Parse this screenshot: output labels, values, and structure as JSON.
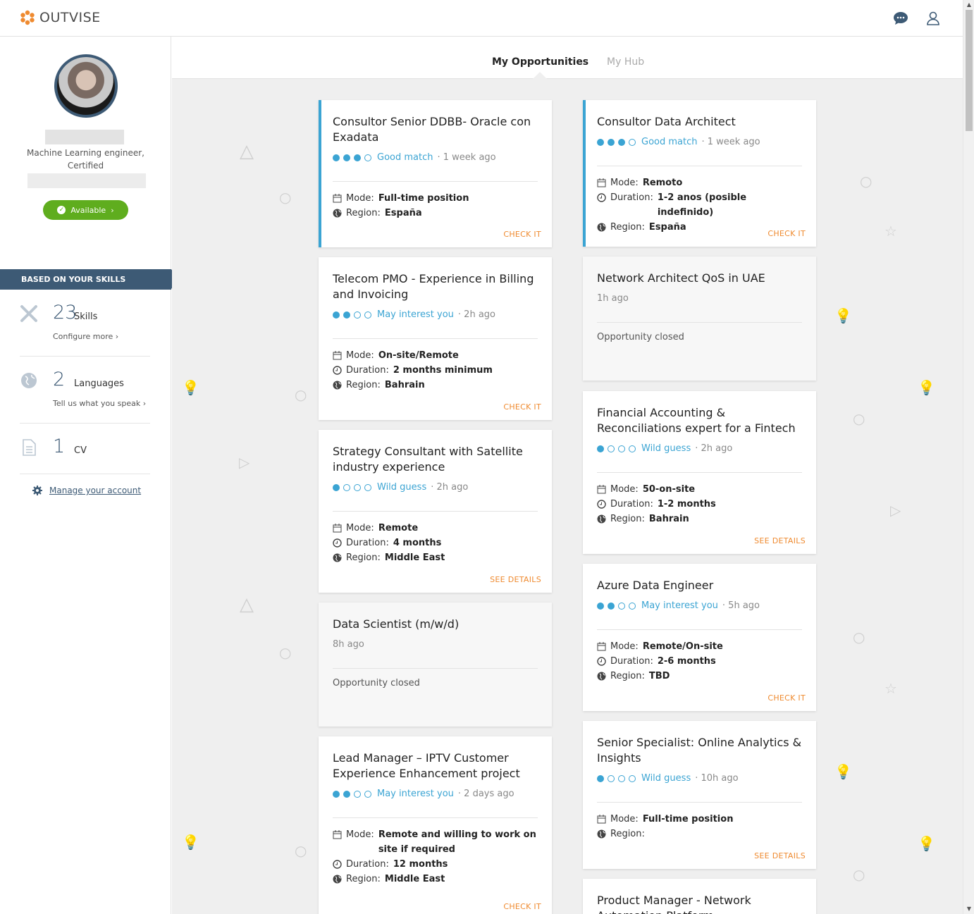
{
  "app": {
    "logo_text": "OUTVISE"
  },
  "header": {
    "chat_icon": "chat-bubble-icon",
    "user_icon": "user-icon"
  },
  "profile": {
    "role": "Machine Learning engineer,",
    "role_line2": "Certified",
    "availability": "Available"
  },
  "skills_banner": "BASED ON YOUR SKILLS",
  "stats": {
    "skills": {
      "count": "23",
      "label": "Skills",
      "link": "Configure more ›"
    },
    "languages": {
      "count": "2",
      "label": "Languages",
      "link": "Tell us what you speak ›"
    },
    "cv": {
      "count": "1",
      "label": "CV"
    }
  },
  "manage_account": "Manage your account",
  "tabs": {
    "active": "My Opportunities",
    "inactive": "My Hub"
  },
  "cards": [
    {
      "title": "Consultor Senior DDBB- Oracle con Exadata",
      "match": "Good match",
      "time": "· 1 week ago",
      "mode": "Full-time position",
      "region": "España",
      "action": "CHECK IT"
    },
    {
      "title": "Telecom PMO - Experience in Billing and Invoicing",
      "match": "May interest you",
      "time": "· 2h ago",
      "mode": "On-site/Remote",
      "duration": "2 months minimum",
      "region": "Bahrain",
      "action": "CHECK IT"
    },
    {
      "title": "Strategy Consultant with Satellite industry experience",
      "match": "Wild guess",
      "time": "· 2h ago",
      "mode": "Remote",
      "duration": "4 months",
      "region": "Middle East",
      "action": "SEE DETAILS"
    },
    {
      "title": "Data Scientist (m/w/d)",
      "time": "8h ago",
      "status": "Opportunity closed"
    },
    {
      "title": "Lead Manager – IPTV Customer Experience Enhancement project",
      "match": "May interest you",
      "time": "· 2 days ago",
      "mode": "Remote and willing to work on site if required",
      "duration": "12 months",
      "region": "Middle East",
      "action": "CHECK IT"
    },
    {
      "title": "Consultor Data Architect",
      "match": "Good match",
      "time": "· 1 week ago",
      "mode": "Remoto",
      "duration": "1-2 anos (posible indefinido)",
      "region": "España",
      "action": "CHECK IT"
    },
    {
      "title": "Network Architect QoS in UAE",
      "time": "1h ago",
      "status": "Opportunity closed"
    },
    {
      "title": "Financial Accounting & Reconciliations expert for a Fintech",
      "match": "Wild guess",
      "time": "· 2h ago",
      "mode": "50-on-site",
      "duration": "1-2 months",
      "region": "Bahrain",
      "action": "SEE DETAILS"
    },
    {
      "title": "Azure Data Engineer",
      "match": "May interest you",
      "time": "· 5h ago",
      "mode": "Remote/On-site",
      "duration": "2-6 months",
      "region": "TBD",
      "action": "CHECK IT"
    },
    {
      "title": "Senior Specialist: Online Analytics & Insights",
      "match": "Wild guess",
      "time": "· 10h ago",
      "mode": "Full-time position",
      "region": "",
      "action": "SEE DETAILS"
    },
    {
      "title": "Product Manager - Network Automation Platform"
    }
  ],
  "labels": {
    "mode": "Mode:",
    "duration": "Duration:",
    "region": "Region:"
  },
  "colors": {
    "brand_orange": "#ef8a2f",
    "primary_blue": "#3ba4d3",
    "navy": "#3d5a75",
    "available_green": "#5fad1e"
  }
}
